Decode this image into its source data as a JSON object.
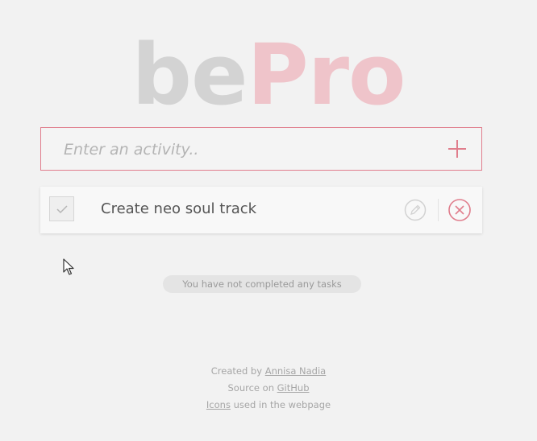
{
  "logo": {
    "part1": "be",
    "part2": "Pro"
  },
  "input": {
    "placeholder": "Enter an activity..",
    "value": ""
  },
  "add_button": {
    "icon": "plus-icon"
  },
  "tasks": [
    {
      "text": "Create neo soul track",
      "completed": false
    }
  ],
  "status": "You have not completed any tasks",
  "footer": {
    "created_prefix": "Created by ",
    "author": "Annisa Nadia",
    "source_prefix": "Source on ",
    "source_link": "GitHub",
    "icons_link": "Icons",
    "icons_suffix": " used in the webpage"
  },
  "colors": {
    "accent": "#e07d8c",
    "logo_gray": "#d3d3d3",
    "logo_pink": "#efc4ca",
    "background": "#f2f2f2"
  }
}
